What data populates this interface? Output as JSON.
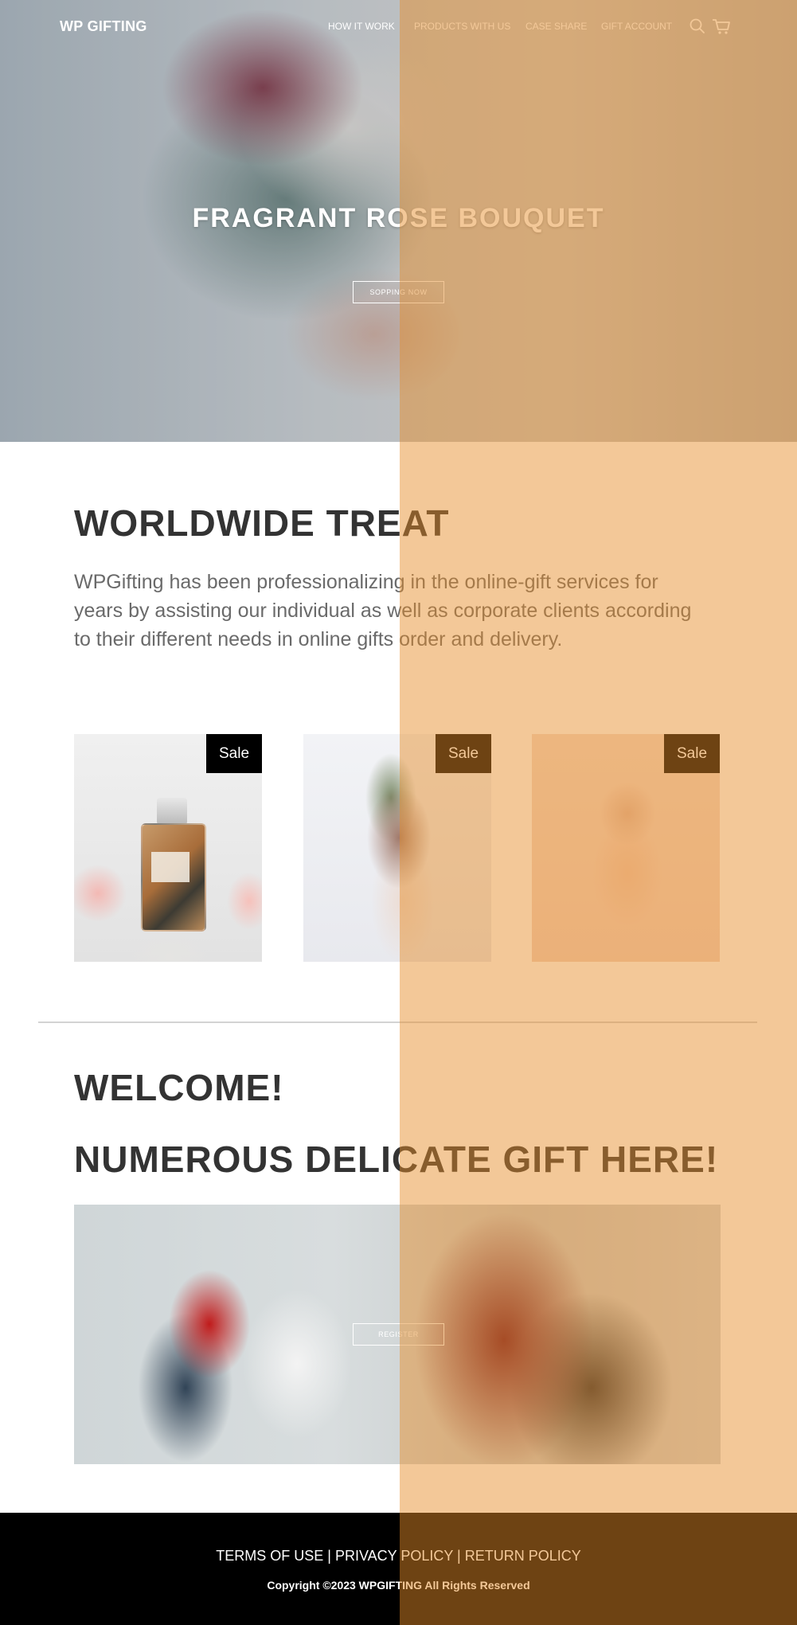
{
  "brand": {
    "logo_text": "WP GIFTING"
  },
  "nav": {
    "links": [
      "HOW IT WORK",
      "PRODUCTS WITH US",
      "CASE SHARE",
      "GIFT ACCOUNT"
    ],
    "icons": [
      "search-icon",
      "cart-icon"
    ]
  },
  "hero": {
    "title": "FRAGRANT ROSE BOUQUET",
    "button_label": "SOPPING NOW"
  },
  "about": {
    "title": "WORLDWIDE TREAT",
    "body": "WPGifting has been professionalizing in the online-gift services for years by assisting our individual as well as corporate clients according to their different needs in online gifts order and delivery."
  },
  "products": {
    "items": [
      {
        "badge": "Sale"
      },
      {
        "badge": "Sale"
      },
      {
        "badge": "Sale"
      }
    ]
  },
  "welcome": {
    "title": "WELCOME!",
    "subtitle": "NUMEROUS DELICATE GIFT HERE!",
    "button_label": "REGISTER"
  },
  "footer": {
    "links": [
      "TERMS OF USE",
      "PRIVACY POLICY",
      "RETURN POLICY"
    ],
    "separator": " | ",
    "copyright": "Copyright ©2023 WPGIFTING All Rights Reserved"
  },
  "colors": {
    "overlay_tint": "#e58c28",
    "footer_bg": "#000000",
    "sale_badge_bg": "#000000"
  }
}
